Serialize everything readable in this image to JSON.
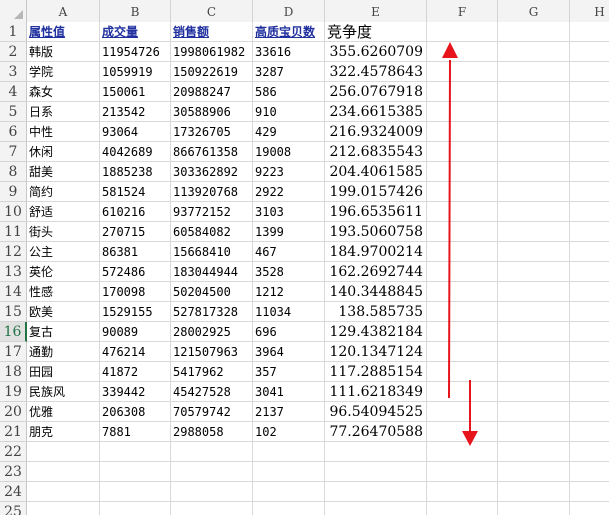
{
  "columns": [
    "A",
    "B",
    "C",
    "D",
    "E",
    "F",
    "G",
    "H"
  ],
  "row_numbers": [
    "1",
    "2",
    "3",
    "4",
    "5",
    "6",
    "7",
    "8",
    "9",
    "10",
    "11",
    "12",
    "13",
    "14",
    "15",
    "16",
    "17",
    "18",
    "19",
    "20",
    "21",
    "22",
    "23",
    "24",
    "25"
  ],
  "active_row": "16",
  "header_row": {
    "a": "属性值",
    "b": "成交量",
    "c": "销售额",
    "d": "高质宝贝数",
    "e": "竞争度"
  },
  "rows": [
    {
      "a": "韩版",
      "b": "11954726",
      "c": "1998061982",
      "d": "33616",
      "e": "355.6260709"
    },
    {
      "a": "学院",
      "b": "1059919",
      "c": "150922619",
      "d": "3287",
      "e": "322.4578643"
    },
    {
      "a": "森女",
      "b": "150061",
      "c": "20988247",
      "d": "586",
      "e": "256.0767918"
    },
    {
      "a": "日系",
      "b": "213542",
      "c": "30588906",
      "d": "910",
      "e": "234.6615385"
    },
    {
      "a": "中性",
      "b": "93064",
      "c": "17326705",
      "d": "429",
      "e": "216.9324009"
    },
    {
      "a": "休闲",
      "b": "4042689",
      "c": "866761358",
      "d": "19008",
      "e": "212.6835543"
    },
    {
      "a": "甜美",
      "b": "1885238",
      "c": "303362892",
      "d": "9223",
      "e": "204.4061585"
    },
    {
      "a": "简约",
      "b": "581524",
      "c": "113920768",
      "d": "2922",
      "e": "199.0157426"
    },
    {
      "a": "舒适",
      "b": "610216",
      "c": "93772152",
      "d": "3103",
      "e": "196.6535611"
    },
    {
      "a": "街头",
      "b": "270715",
      "c": "60584082",
      "d": "1399",
      "e": "193.5060758"
    },
    {
      "a": "公主",
      "b": "86381",
      "c": "15668410",
      "d": "467",
      "e": "184.9700214"
    },
    {
      "a": "英伦",
      "b": "572486",
      "c": "183044944",
      "d": "3528",
      "e": "162.2692744"
    },
    {
      "a": "性感",
      "b": "170098",
      "c": "50204500",
      "d": "1212",
      "e": "140.3448845"
    },
    {
      "a": "欧美",
      "b": "1529155",
      "c": "527817328",
      "d": "11034",
      "e": "138.585735"
    },
    {
      "a": "复古",
      "b": "90089",
      "c": "28002925",
      "d": "696",
      "e": "129.4382184"
    },
    {
      "a": "通勤",
      "b": "476214",
      "c": "121507963",
      "d": "3964",
      "e": "120.1347124"
    },
    {
      "a": "田园",
      "b": "41872",
      "c": "5417962",
      "d": "357",
      "e": "117.2885154"
    },
    {
      "a": "民族风",
      "b": "339442",
      "c": "45427528",
      "d": "3041",
      "e": "111.6218349"
    },
    {
      "a": "优雅",
      "b": "206308",
      "c": "70579742",
      "d": "2137",
      "e": "96.54094525"
    },
    {
      "a": "朋克",
      "b": "7881",
      "c": "2988058",
      "d": "102",
      "e": "77.26470588"
    }
  ],
  "colors": {
    "header_text": "#1f2f9e",
    "arrow": "#e8141b",
    "active_row": "#217346",
    "gridline": "#d9d9d9"
  }
}
